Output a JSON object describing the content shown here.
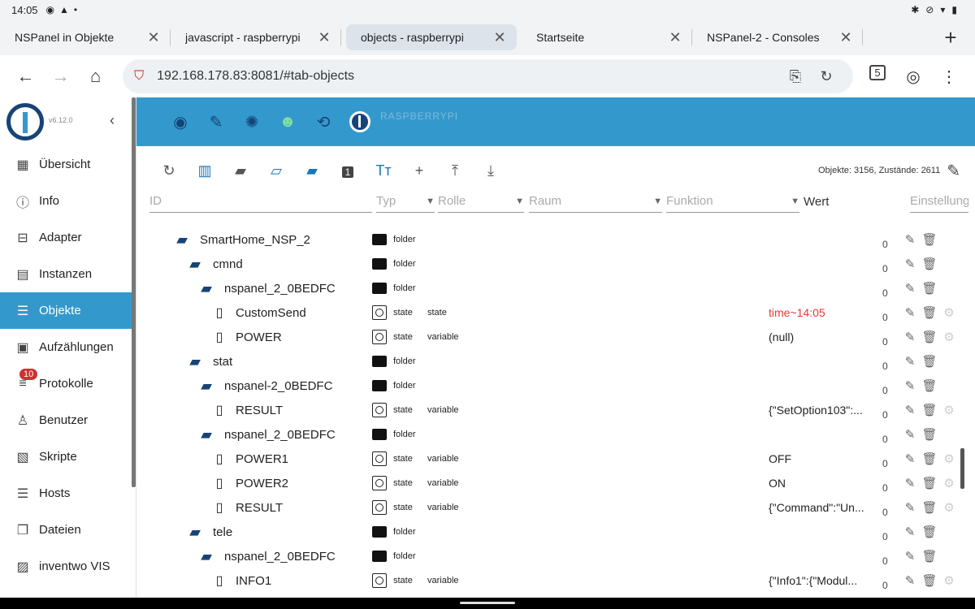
{
  "status": {
    "time": "14:05"
  },
  "tabs": [
    {
      "label": "NSPanel in Objekte",
      "active": false
    },
    {
      "label": "javascript - raspberrypi",
      "active": false
    },
    {
      "label": "objects - raspberrypi",
      "active": true
    },
    {
      "label": "Startseite",
      "active": false
    },
    {
      "label": "NSPanel-2 - Consoles",
      "active": false
    }
  ],
  "address": {
    "url": "192.168.178.83:8081/#tab-objects",
    "tab_count": "5"
  },
  "sidebar": {
    "version": "v6.12.0",
    "items": [
      {
        "label": "Übersicht",
        "icon": "grid-icon",
        "active": false
      },
      {
        "label": "Info",
        "icon": "info-icon",
        "active": false
      },
      {
        "label": "Adapter",
        "icon": "store-icon",
        "active": false
      },
      {
        "label": "Instanzen",
        "icon": "instances-icon",
        "active": false
      },
      {
        "label": "Objekte",
        "icon": "list-icon",
        "active": true
      },
      {
        "label": "Aufzählungen",
        "icon": "enum-icon",
        "active": false
      },
      {
        "label": "Protokolle",
        "icon": "log-icon",
        "active": false,
        "badge": "10"
      },
      {
        "label": "Benutzer",
        "icon": "user-icon",
        "active": false
      },
      {
        "label": "Skripte",
        "icon": "js-icon",
        "active": false
      },
      {
        "label": "Hosts",
        "icon": "hosts-icon",
        "active": false
      },
      {
        "label": "Dateien",
        "icon": "files-icon",
        "active": false
      },
      {
        "label": "inventwo VIS",
        "icon": "vis-icon",
        "active": false
      }
    ]
  },
  "appbar": {
    "hostname": "RASPBERRYPI"
  },
  "toolbar": {
    "counts": "Objekte: 3156, Zustände: 2611"
  },
  "columns": {
    "id": "ID",
    "type": "Typ",
    "role": "Rolle",
    "room": "Raum",
    "function": "Funktion",
    "value": "Wert",
    "settings": "Einstellung"
  },
  "rows": [
    {
      "name": "SmartHome_NSP_2",
      "level": 1,
      "kind": "folder",
      "type": "folder",
      "role": "",
      "value": "",
      "count": "0",
      "red": false
    },
    {
      "name": "cmnd",
      "level": 2,
      "kind": "folder",
      "type": "folder",
      "role": "",
      "value": "",
      "count": "0",
      "red": false
    },
    {
      "name": "nspanel_2_0BEDFC",
      "level": 3,
      "kind": "folder",
      "type": "folder",
      "role": "",
      "value": "",
      "count": "0",
      "red": false
    },
    {
      "name": "CustomSend",
      "level": 4,
      "kind": "state",
      "type": "state",
      "role": "state",
      "value": "time~14:05",
      "count": "0",
      "red": true
    },
    {
      "name": "POWER",
      "level": 4,
      "kind": "state",
      "type": "state",
      "role": "variable",
      "value": "(null)",
      "count": "0",
      "red": false
    },
    {
      "name": "stat",
      "level": 2,
      "kind": "folder",
      "type": "folder",
      "role": "",
      "value": "",
      "count": "0",
      "red": false
    },
    {
      "name": "nspanel-2_0BEDFC",
      "level": 3,
      "kind": "folder",
      "type": "folder",
      "role": "",
      "value": "",
      "count": "0",
      "red": false
    },
    {
      "name": "RESULT",
      "level": 4,
      "kind": "state",
      "type": "state",
      "role": "variable",
      "value": "{\"SetOption103\":...",
      "count": "0",
      "red": false
    },
    {
      "name": "nspanel_2_0BEDFC",
      "level": 3,
      "kind": "folder",
      "type": "folder",
      "role": "",
      "value": "",
      "count": "0",
      "red": false
    },
    {
      "name": "POWER1",
      "level": 4,
      "kind": "state",
      "type": "state",
      "role": "variable",
      "value": "OFF",
      "count": "0",
      "red": false
    },
    {
      "name": "POWER2",
      "level": 4,
      "kind": "state",
      "type": "state",
      "role": "variable",
      "value": "ON",
      "count": "0",
      "red": false
    },
    {
      "name": "RESULT",
      "level": 4,
      "kind": "state",
      "type": "state",
      "role": "variable",
      "value": "{\"Command\":\"Un...",
      "count": "0",
      "red": false
    },
    {
      "name": "tele",
      "level": 2,
      "kind": "folder",
      "type": "folder",
      "role": "",
      "value": "",
      "count": "0",
      "red": false
    },
    {
      "name": "nspanel_2_0BEDFC",
      "level": 3,
      "kind": "folder",
      "type": "folder",
      "role": "",
      "value": "",
      "count": "0",
      "red": false
    },
    {
      "name": "INFO1",
      "level": 4,
      "kind": "state",
      "type": "state",
      "role": "variable",
      "value": "{\"Info1\":{\"Modul...",
      "count": "0",
      "red": false
    }
  ]
}
